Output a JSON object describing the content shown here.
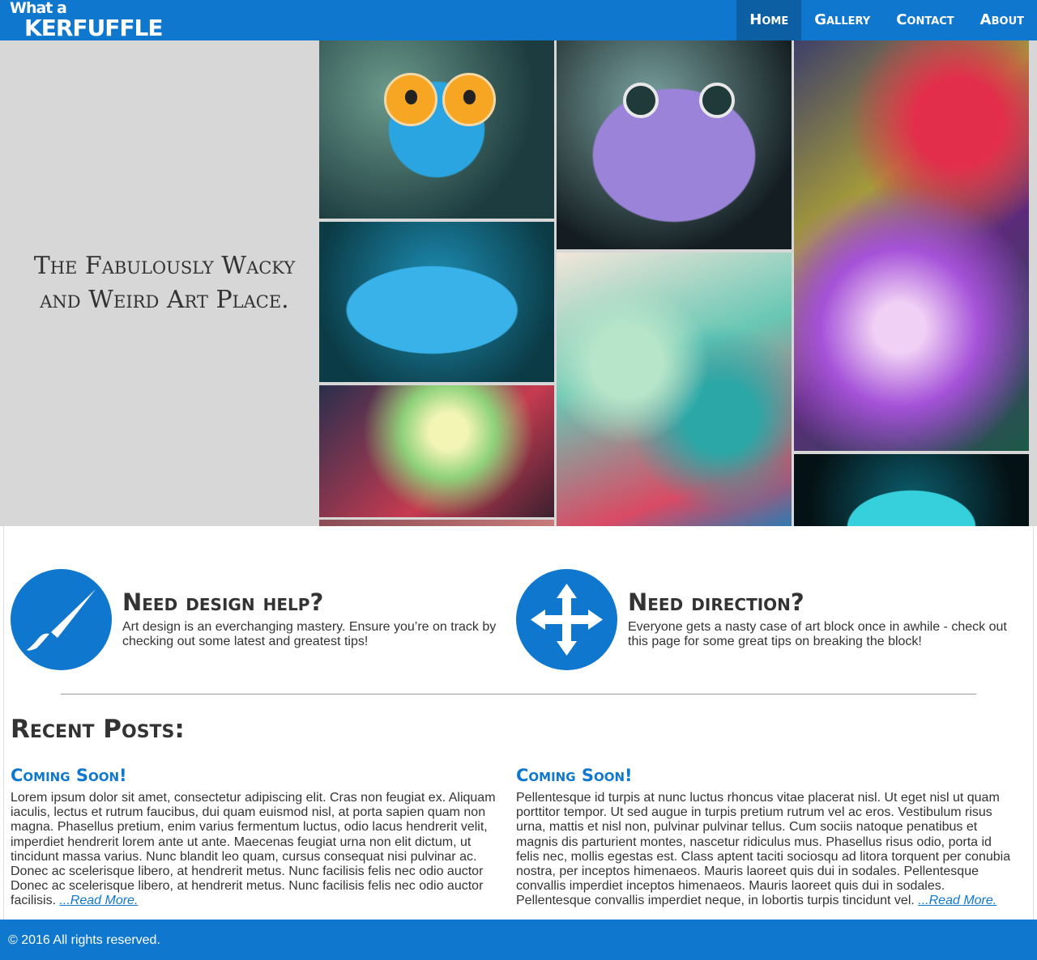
{
  "header": {
    "logo_line1": "What a",
    "logo_line2": "KERFUFFLE",
    "nav": [
      "Home",
      "Gallery",
      "Contact",
      "About"
    ],
    "active_nav": "Home",
    "accent_color": "#0f78ce"
  },
  "hero": {
    "tagline": "The Fabulously Wacky and Weird Art Place."
  },
  "services": [
    {
      "icon": "paintbrush-icon",
      "title": "Need design help?",
      "text": "Art design is an everchanging mastery. Ensure you’re on track by checking out some latest and greatest tips!"
    },
    {
      "icon": "move-arrows-icon",
      "title": "Need direction?",
      "text": "Everyone gets a nasty case of art block once in awhile - check out this page for some great tips on breaking the block!"
    }
  ],
  "recent": {
    "heading": "Recent Posts:",
    "posts": [
      {
        "title": "Coming Soon!",
        "body": "Lorem ipsum dolor sit amet, consectetur adipiscing elit. Cras non feugiat ex. Aliquam iaculis, lectus et rutrum faucibus, dui quam euismod nisl, at porta sapien quam non magna. Phasellus pretium, enim varius fermentum luctus, odio lacus hendrerit velit, imperdiet hendrerit lorem ante ut ante. Maecenas feugiat urna non elit dictum, ut tincidunt massa varius. Nunc blandit leo quam, cursus consequat nisi pulvinar ac. Donec ac scelerisque libero, at hendrerit metus. Nunc facilisis felis nec odio auctor Donec ac scelerisque libero, at hendrerit metus. Nunc facilisis felis nec odio auctor facilisis.",
        "link": "...Read More."
      },
      {
        "title": "Coming Soon!",
        "body": "Pellentesque id turpis at nunc luctus rhoncus vitae placerat nisl. Ut eget nisl ut quam porttitor tempor. Ut sed augue in turpis pretium rutrum vel ac eros. Vestibulum risus urna, mattis et nisl non, pulvinar pulvinar tellus. Cum sociis natoque penatibus et magnis dis parturient montes, nascetur ridiculus mus. Phasellus risus odio, porta id felis nec, mollis egestas est. Class aptent taciti sociosqu ad litora torquent per conubia nostra, per inceptos himenaeos. Mauris laoreet quis dui in sodales. Pellentesque convallis imperdiet inceptos himenaeos. Mauris laoreet quis dui in sodales. Pellentesque convallis imperdiet neque, in lobortis turpis tincidunt vel.",
        "link": "...Read More."
      }
    ]
  },
  "footer": {
    "text": "© 2016 All rights reserved."
  }
}
